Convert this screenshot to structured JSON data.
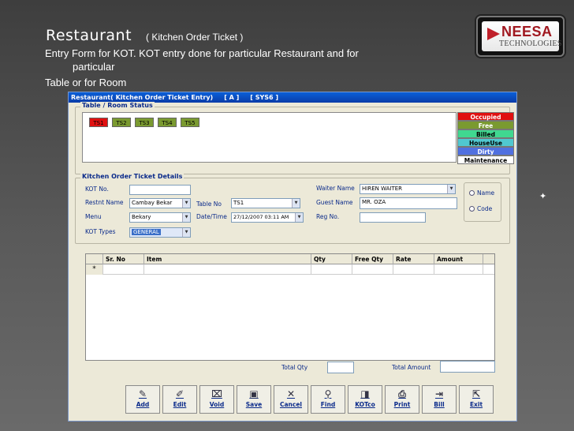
{
  "slide": {
    "title": "Restaurant",
    "subtitle": "( Kitchen Order Ticket )",
    "desc_line1": "Entry Form for KOT. KOT entry done for particular Restaurant and for",
    "desc_line2": "particular",
    "desc_line3": "Table or for Room",
    "logo_name": "NEESA",
    "logo_sub": "TECHNOLOGIES"
  },
  "window": {
    "title": "Restaurant( Kitchen Order Ticket Entry)",
    "tag1": "[ A ]",
    "tag2": "[ SYS6 ]"
  },
  "table_status": {
    "label": "Table / Room Status",
    "tables": [
      {
        "name": "TS1",
        "color": "#e01010"
      },
      {
        "name": "TS2",
        "color": "#7a9a30"
      },
      {
        "name": "TS3",
        "color": "#7a9a30"
      },
      {
        "name": "TS4",
        "color": "#7a9a30"
      },
      {
        "name": "TS5",
        "color": "#7a9a30"
      }
    ],
    "legend": [
      {
        "label": "Occupied",
        "color": "#e01010"
      },
      {
        "label": "Free",
        "color": "#7a9a30"
      },
      {
        "label": "Billed",
        "color": "#40d890"
      },
      {
        "label": "HouseUse",
        "color": "#50c8d0"
      },
      {
        "label": "Dirty",
        "color": "#5070e0"
      },
      {
        "label": "Maintenance",
        "color": "#ffffff"
      }
    ]
  },
  "details": {
    "label": "Kitchen Order Ticket Details",
    "kot_no_label": "KOT No.",
    "kot_no": "",
    "restnt_label": "Restnt Name",
    "restnt": "Cambay Bekar",
    "menu_label": "Menu",
    "menu": "Bekary",
    "kot_types_label": "KOT Types",
    "kot_types": "GENERAL",
    "table_no_label": "Table No",
    "table_no": "TS1",
    "datetime_label": "Date/Time",
    "datetime": "27/12/2007 03:11 AM",
    "waiter_label": "Waiter Name",
    "waiter": "HIREN  WAITER",
    "guest_label": "Guest Name",
    "guest": "MR. OZA",
    "reg_label": "Reg No.",
    "reg": "",
    "radio_name": "Name",
    "radio_code": "Code"
  },
  "grid": {
    "columns": [
      "Sr. No",
      "Item",
      "Qty",
      "Free Qty",
      "Rate",
      "Amount"
    ],
    "new_row_marker": "*"
  },
  "totals": {
    "qty_label": "Total Qty",
    "qty": "",
    "amount_label": "Total Amount",
    "amount": ""
  },
  "buttons": {
    "add": "Add",
    "edit": "Edit",
    "void": "Void",
    "save": "Save",
    "cancel": "Cancel",
    "find": "Find",
    "kotco": "KOTco",
    "print": "Print",
    "bill": "Bill",
    "exit": "Exit"
  }
}
